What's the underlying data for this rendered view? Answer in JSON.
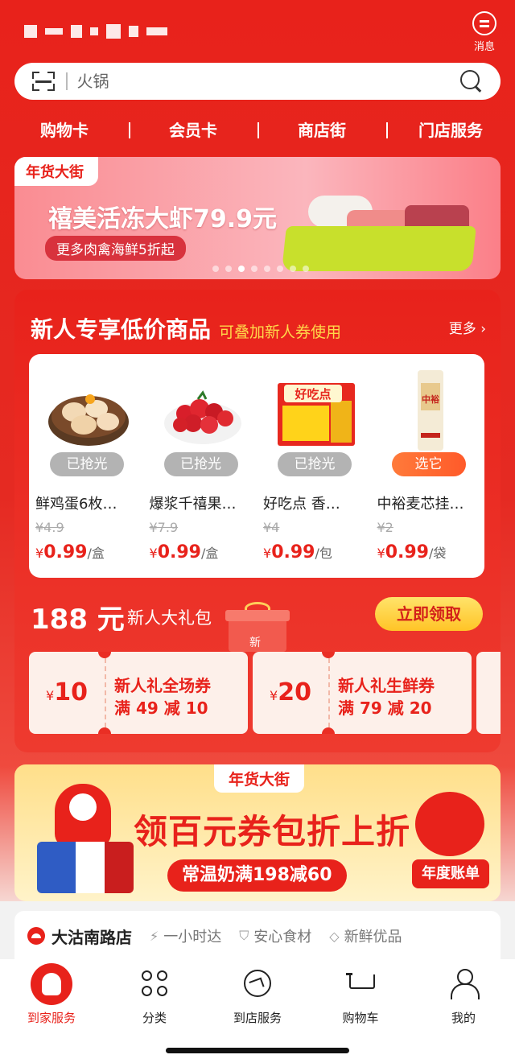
{
  "header": {
    "message_label": "消息"
  },
  "search": {
    "placeholder": "火锅"
  },
  "top_nav": [
    "购物卡",
    "会员卡",
    "商店街",
    "门店服务"
  ],
  "banner": {
    "tag": "年货大街",
    "title": "禧美活冻大虾79.9元",
    "subtitle": "更多肉禽海鲜5折起",
    "slides": 8,
    "active_slide": 3
  },
  "new_user": {
    "title": "新人专享低价商品",
    "subtitle": "可叠加新人券使用",
    "more": "更多 ›",
    "products": [
      {
        "name": "鲜鸡蛋6枚…",
        "status": "已抢光",
        "status_style": "gray",
        "old_price": "¥4.9",
        "currency": "¥",
        "price": "0.99",
        "unit": "/盒",
        "icon": "eggs-image"
      },
      {
        "name": "爆浆千禧果…",
        "status": "已抢光",
        "status_style": "gray",
        "old_price": "¥7.9",
        "currency": "¥",
        "price": "0.99",
        "unit": "/盒",
        "icon": "cherry-tomato-image"
      },
      {
        "name": "好吃点 香…",
        "status": "已抢光",
        "status_style": "gray",
        "old_price": "¥4",
        "currency": "¥",
        "price": "0.99",
        "unit": "/包",
        "icon": "biscuit-package-image",
        "package_text": "好吃点"
      },
      {
        "name": "中裕麦芯挂…",
        "status": "选它",
        "status_style": "orange",
        "old_price": "¥2",
        "currency": "¥",
        "price": "0.99",
        "unit": "/袋",
        "icon": "noodle-package-image",
        "package_text": "中裕"
      }
    ],
    "gift_amount": "188 元",
    "gift_label": "新人大礼包",
    "gift_box_text": "新",
    "claim_button": "立即领取",
    "coupons": [
      {
        "currency": "¥",
        "amount": "10",
        "name": "新人礼全场券",
        "rule": "满 49 减 10"
      },
      {
        "currency": "¥",
        "amount": "20",
        "name": "新人礼生鲜券",
        "rule": "满 79 减 20"
      }
    ]
  },
  "promo": {
    "tag": "年货大街",
    "headline": "领百元券包折上折",
    "offer": "常温奶满198减60",
    "yearly": "年度账单"
  },
  "store": {
    "name": "大沽南路店",
    "features": [
      {
        "icon": "lightning-icon",
        "glyph": "⚡",
        "label": "一小时达"
      },
      {
        "icon": "shield-icon",
        "glyph": "⛉",
        "label": "安心食材"
      },
      {
        "icon": "diamond-icon",
        "glyph": "◇",
        "label": "新鲜优品"
      }
    ]
  },
  "tabbar": [
    {
      "label": "到家服务",
      "icon": "home-service-icon",
      "active": true
    },
    {
      "label": "分类",
      "icon": "category-icon",
      "active": false
    },
    {
      "label": "到店服务",
      "icon": "store-service-icon",
      "active": false
    },
    {
      "label": "购物车",
      "icon": "cart-icon",
      "active": false
    },
    {
      "label": "我的",
      "icon": "profile-icon",
      "active": false
    }
  ],
  "colors": {
    "brand_red": "#e8221b",
    "gold": "#ffc427",
    "gray_pill": "#b3b3b3"
  }
}
